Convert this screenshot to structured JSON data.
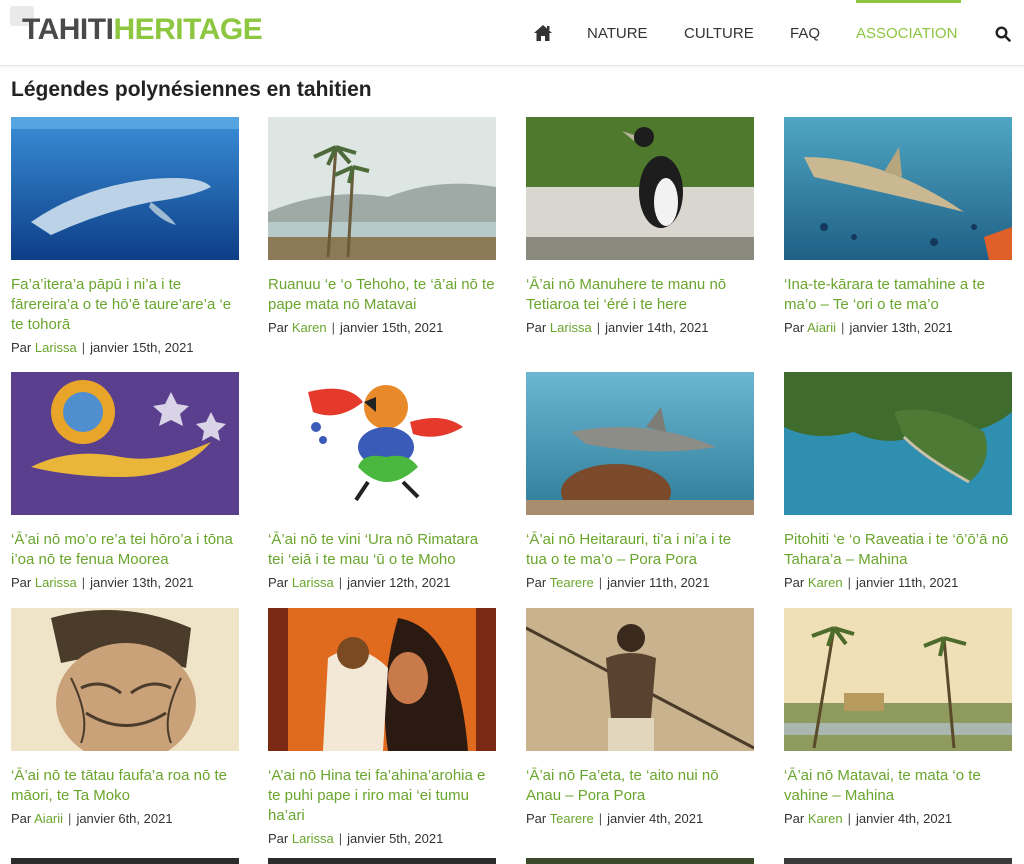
{
  "header": {
    "logo_part1": "TAHITI",
    "logo_part2": "HERITAGE",
    "nav": [
      {
        "label": "NATURE"
      },
      {
        "label": "CULTURE"
      },
      {
        "label": "FAQ"
      },
      {
        "label": "ASSOCIATION",
        "active": true
      }
    ],
    "accent_color": "#8dc63f"
  },
  "page": {
    "title": "Légendes polynésiennes en tahitien"
  },
  "posts": [
    {
      "title": "Fa’a’itera’a pāpū i ni’a i te fārereira’a o te hō’ē taure’are’a ‘e te tohorā",
      "by": "Par",
      "author": "Larissa",
      "date": "janvier 15th, 2021"
    },
    {
      "title": "Ruanuu ‘e ‘o Tehoho, te ‘ā’ai nō te pape mata nō Matavai",
      "by": "Par",
      "author": "Karen",
      "date": "janvier 15th, 2021"
    },
    {
      "title": "‘Ā’ai nō Manuhere te manu nō Tetiaroa tei ‘éré i te here",
      "by": "Par",
      "author": "Larissa",
      "date": "janvier 14th, 2021"
    },
    {
      "title": "‘Ina-te-kārara te tamahine a te ma’o – Te ‘ori o te ma’o",
      "by": "Par",
      "author": "Aiarii",
      "date": "janvier 13th, 2021"
    },
    {
      "title": "‘Ā’ai nō mo’o re’a tei hōro’a i tōna i’oa nō te fenua Moorea",
      "by": "Par",
      "author": "Larissa",
      "date": "janvier 13th, 2021"
    },
    {
      "title": "‘Ā’ai nō te vini ‘Ura nō Rimatara tei ‘eiā i te mau ‘ū o te Moho",
      "by": "Par",
      "author": "Larissa",
      "date": "janvier 12th, 2021"
    },
    {
      "title": "‘Ā’ai nō Heitarauri, ti’a i ni’a i te tua o te ma’o – Pora Pora",
      "by": "Par",
      "author": "Tearere",
      "date": "janvier 11th, 2021"
    },
    {
      "title": "Pitohiti ‘e ‘o Raveatia i te ‘ō’ō’ā nō Tahara’a – Mahina",
      "by": "Par",
      "author": "Karen",
      "date": "janvier 11th, 2021"
    },
    {
      "title": "‘Ā’ai nō te tātau faufa’a roa nō te māori, te Ta Moko",
      "by": "Par",
      "author": "Aiarii",
      "date": "janvier 6th, 2021"
    },
    {
      "title": "‘A’ai nō Hina tei fa’ahina’arohia e te puhi pape i riro mai ‘ei tumu ha’ari",
      "by": "Par",
      "author": "Larissa",
      "date": "janvier 5th, 2021"
    },
    {
      "title": "‘Ā’ai nō Fa’eta, te ‘aito nui nō Anau – Pora Pora",
      "by": "Par",
      "author": "Tearere",
      "date": "janvier 4th, 2021"
    },
    {
      "title": "‘Ā’ai nō Matavai, te mata ‘o te vahine – Mahina",
      "by": "Par",
      "author": "Karen",
      "date": "janvier 4th, 2021"
    }
  ]
}
